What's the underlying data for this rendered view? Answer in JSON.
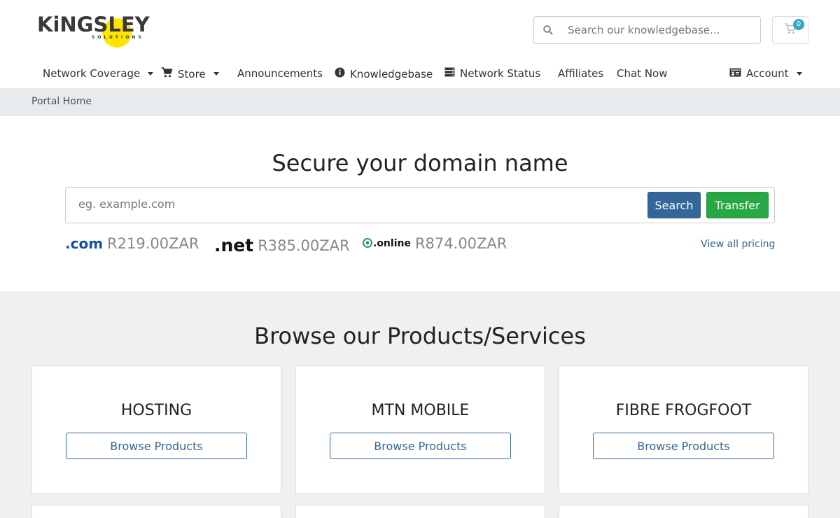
{
  "brand": {
    "wordmark": "KiNGSLEY",
    "tagline": "SOLUTIONS",
    "sun_color": "#ffe600"
  },
  "header": {
    "search_placeholder": "Search our knowledgebase...",
    "cart_count": "0"
  },
  "nav": {
    "network_coverage": "Network Coverage",
    "store": "Store",
    "announcements": "Announcements",
    "knowledgebase": "Knowledgebase",
    "network_status": "Network Status",
    "affiliates": "Affiliates",
    "chat_now": "Chat Now",
    "account": "Account"
  },
  "breadcrumb": {
    "home": "Portal Home"
  },
  "domain": {
    "title": "Secure your domain name",
    "placeholder": "eg. example.com",
    "search_label": "Search",
    "transfer_label": "Transfer",
    "tlds": [
      {
        "name": ".com",
        "price": "R219.00ZAR"
      },
      {
        "name": ".net",
        "price": "R385.00ZAR"
      },
      {
        "name": ".online",
        "price": "R874.00ZAR"
      }
    ],
    "view_all": "View all pricing"
  },
  "products": {
    "title": "Browse our Products/Services",
    "cards": [
      {
        "title": "HOSTING",
        "button": "Browse Products"
      },
      {
        "title": "MTN MOBILE",
        "button": "Browse Products"
      },
      {
        "title": "FIBRE FROGFOOT",
        "button": "Browse Products"
      }
    ]
  },
  "colors": {
    "primary": "#336699",
    "success": "#28a745",
    "badge": "#34a7c1"
  }
}
